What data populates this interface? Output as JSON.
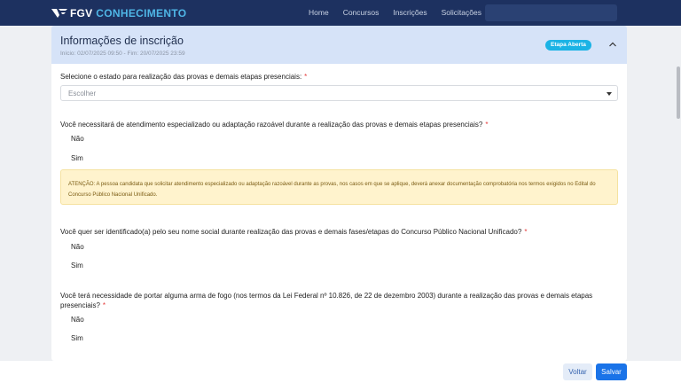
{
  "brand": {
    "prefix": "FGV",
    "name": "CONHECIMENTO",
    "accent": "#4fb6e6",
    "bar_color": "#1d3160"
  },
  "nav": {
    "items": [
      "Home",
      "Concursos",
      "Inscrições",
      "Solicitações"
    ],
    "search_placeholder": ""
  },
  "section": {
    "title": "Informações de inscrição",
    "dates": "Início: 02/07/2025 09:50 - Fim: 20/07/2025 23:59",
    "badge": "Etapa Aberta",
    "badge_color": "#1bb3e5",
    "collapse_icon": "chevron-up-icon"
  },
  "questions": {
    "state": {
      "label": "Selecione o estado para realização das provas e demais etapas presenciais:",
      "required_mark": "*",
      "value": "Escolher"
    },
    "special_care": {
      "label": "Você necessitará de atendimento especializado ou adaptação razoável durante a realização das provas e demais etapas presenciais?",
      "required_mark": "*",
      "options": [
        "Não",
        "Sim"
      ]
    },
    "alert": "ATENÇÃO: A pessoa candidata que solicitar atendimento especializado ou adaptação razoável durante as provas, nos casos em que se aplique, deverá anexar documentação comprobatória nos termos exigidos no Edital do Concurso Público Nacional Unificado.",
    "social_name": {
      "label": "Você quer ser identificado(a) pelo seu nome social durante realização das provas e demais fases/etapas do Concurso Público Nacional Unificado?",
      "required_mark": "*",
      "options": [
        "Não",
        "Sim"
      ]
    },
    "firearm": {
      "label": "Você terá necessidade de portar alguma arma de fogo (nos termos da Lei Federal nº 10.826, de 22 de dezembro 2003) durante a realização das provas e demais etapas presenciais?",
      "required_mark": "*",
      "options": [
        "Não",
        "Sim"
      ]
    }
  },
  "footer": {
    "back_label": "Voltar",
    "save_label": "Salvar",
    "save_color": "#1a73e8"
  }
}
